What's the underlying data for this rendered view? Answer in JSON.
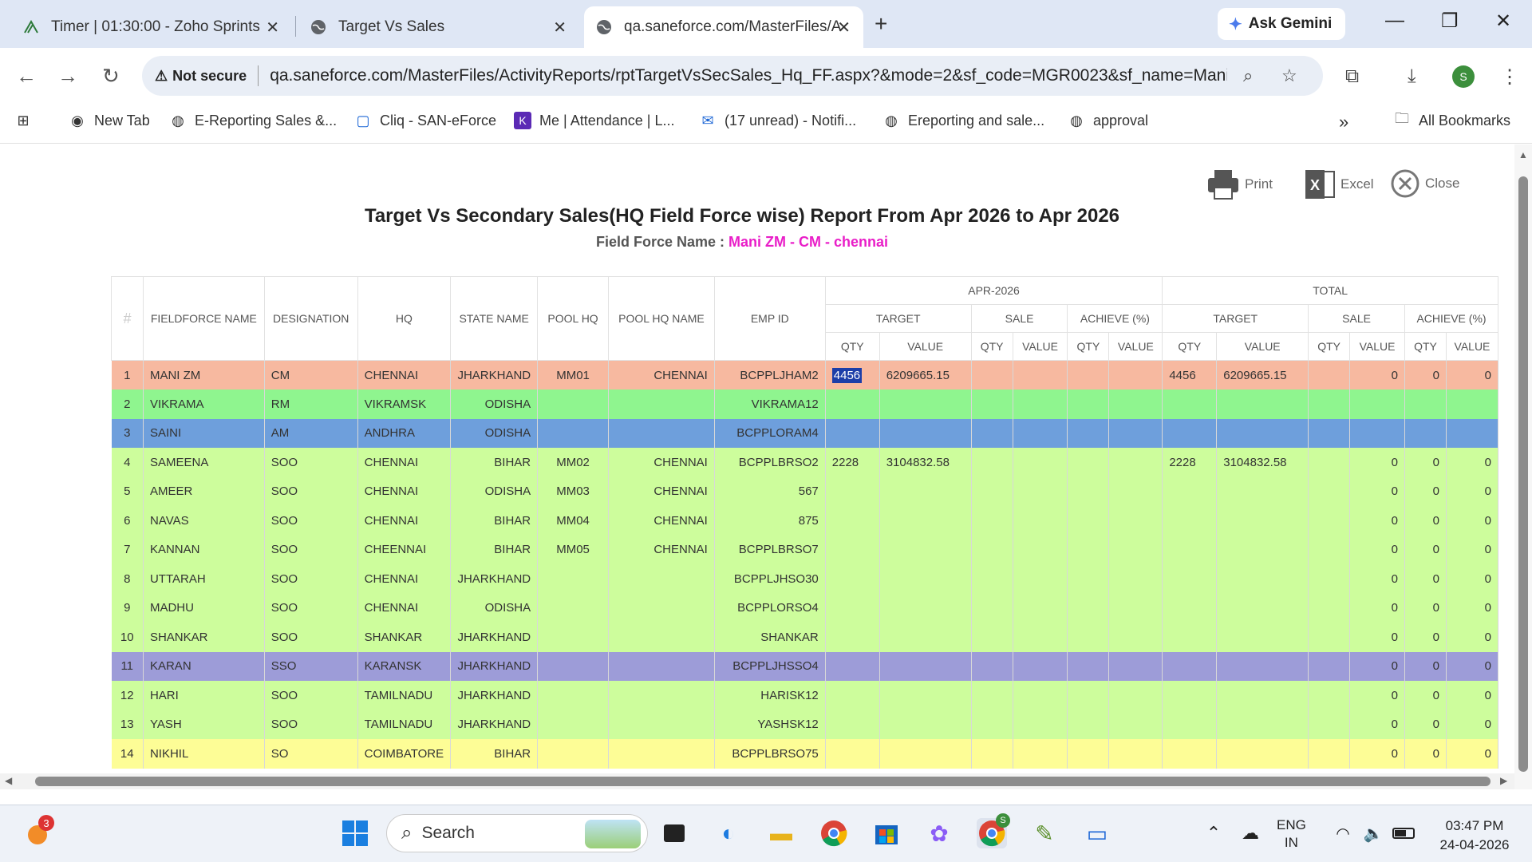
{
  "browser": {
    "tabs": [
      {
        "title": "Timer | 01:30:00 - Zoho Sprints"
      },
      {
        "title": "Target Vs Sales"
      },
      {
        "title": "qa.saneforce.com/MasterFiles/A"
      }
    ],
    "new_tab": "+",
    "gemini_label": "Ask Gemini",
    "not_secure": "Not secure",
    "url": "qa.saneforce.com/MasterFiles/ActivityReports/rptTargetVsSecSales_Hq_FF.aspx?&mode=2&sf_code=MGR0023&sf_name=Mani...",
    "profile_initial": "S",
    "bookmarks": [
      "New Tab",
      "E-Reporting Sales &...",
      "Cliq - SAN-eForce",
      "Me | Attendance | L...",
      "(17 unread) - Notifi...",
      "Ereporting and sale...",
      "approval"
    ],
    "more_bookmarks": "»",
    "all_bookmarks": "All Bookmarks"
  },
  "actions": {
    "print": "Print",
    "excel": "Excel",
    "close": "Close"
  },
  "report": {
    "title": "Target Vs Secondary Sales(HQ Field Force wise) Report From Apr 2026 to Apr 2026",
    "ff_label": "Field Force Name :",
    "ff_name": "Mani ZM - CM - chennai"
  },
  "table": {
    "headers": {
      "num": "#",
      "fieldforce": "FIELDFORCE NAME",
      "designation": "DESIGNATION",
      "hq": "HQ",
      "state": "STATE NAME",
      "pool_hq": "POOL HQ",
      "pool_hq_name": "POOL HQ NAME",
      "emp_id": "EMP ID",
      "month": "APR-2026",
      "total": "TOTAL",
      "target": "TARGET",
      "sale": "SALE",
      "achieve": "ACHIEVE (%)",
      "qty": "QTY",
      "value": "VALUE"
    },
    "rows": [
      {
        "n": "1",
        "name": "MANI ZM",
        "desg": "CM",
        "hq": "CHENNAI",
        "state": "JHARKHAND",
        "pool": "MM01",
        "poolname": "CHENNAI",
        "emp": "BCPPLJHAM2",
        "t_qty": "4456",
        "t_val": "6209665.15",
        "s_qty": "",
        "s_val": "",
        "a_qty": "",
        "a_val": "",
        "tt_qty": "4456",
        "tt_val": "6209665.15",
        "ts_qty": "",
        "ts_val": "0",
        "ta_qty": "0",
        "ta_val": "0",
        "bg": "#f7b9a0"
      },
      {
        "n": "2",
        "name": "VIKRAMA",
        "desg": "RM",
        "hq": "VIKRAMSK",
        "state": "ODISHA",
        "pool": "",
        "poolname": "",
        "emp": "VIKRAMA12",
        "t_qty": "",
        "t_val": "",
        "s_qty": "",
        "s_val": "",
        "a_qty": "",
        "a_val": "",
        "tt_qty": "",
        "tt_val": "",
        "ts_qty": "",
        "ts_val": "",
        "ta_qty": "",
        "ta_val": "",
        "bg": "#8ff58f"
      },
      {
        "n": "3",
        "name": "SAINI",
        "desg": "AM",
        "hq": "ANDHRA",
        "state": "ODISHA",
        "pool": "",
        "poolname": "",
        "emp": "BCPPLORAM4",
        "t_qty": "",
        "t_val": "",
        "s_qty": "",
        "s_val": "",
        "a_qty": "",
        "a_val": "",
        "tt_qty": "",
        "tt_val": "",
        "ts_qty": "",
        "ts_val": "",
        "ta_qty": "",
        "ta_val": "",
        "bg": "#6e9fdc"
      },
      {
        "n": "4",
        "name": "SAMEENA",
        "desg": "SOO",
        "hq": "CHENNAI",
        "state": "BIHAR",
        "pool": "MM02",
        "poolname": "CHENNAI",
        "emp": "BCPPLBRSO2",
        "t_qty": "2228",
        "t_val": "3104832.58",
        "s_qty": "",
        "s_val": "",
        "a_qty": "",
        "a_val": "",
        "tt_qty": "2228",
        "tt_val": "3104832.58",
        "ts_qty": "",
        "ts_val": "0",
        "ta_qty": "0",
        "ta_val": "0",
        "bg": "#cdfd9c"
      },
      {
        "n": "5",
        "name": "AMEER",
        "desg": "SOO",
        "hq": "CHENNAI",
        "state": "ODISHA",
        "pool": "MM03",
        "poolname": "CHENNAI",
        "emp": "567",
        "t_qty": "",
        "t_val": "",
        "s_qty": "",
        "s_val": "",
        "a_qty": "",
        "a_val": "",
        "tt_qty": "",
        "tt_val": "",
        "ts_qty": "",
        "ts_val": "0",
        "ta_qty": "0",
        "ta_val": "0",
        "bg": "#cdfd9c"
      },
      {
        "n": "6",
        "name": "NAVAS",
        "desg": "SOO",
        "hq": "CHENNAI",
        "state": "BIHAR",
        "pool": "MM04",
        "poolname": "CHENNAI",
        "emp": "875",
        "t_qty": "",
        "t_val": "",
        "s_qty": "",
        "s_val": "",
        "a_qty": "",
        "a_val": "",
        "tt_qty": "",
        "tt_val": "",
        "ts_qty": "",
        "ts_val": "0",
        "ta_qty": "0",
        "ta_val": "0",
        "bg": "#cdfd9c"
      },
      {
        "n": "7",
        "name": "KANNAN",
        "desg": "SOO",
        "hq": "CHEENNAI",
        "state": "BIHAR",
        "pool": "MM05",
        "poolname": "CHENNAI",
        "emp": "BCPPLBRSO7",
        "t_qty": "",
        "t_val": "",
        "s_qty": "",
        "s_val": "",
        "a_qty": "",
        "a_val": "",
        "tt_qty": "",
        "tt_val": "",
        "ts_qty": "",
        "ts_val": "0",
        "ta_qty": "0",
        "ta_val": "0",
        "bg": "#cdfd9c"
      },
      {
        "n": "8",
        "name": "UTTARAH",
        "desg": "SOO",
        "hq": "CHENNAI",
        "state": "JHARKHAND",
        "pool": "",
        "poolname": "",
        "emp": "BCPPLJHSO30",
        "t_qty": "",
        "t_val": "",
        "s_qty": "",
        "s_val": "",
        "a_qty": "",
        "a_val": "",
        "tt_qty": "",
        "tt_val": "",
        "ts_qty": "",
        "ts_val": "0",
        "ta_qty": "0",
        "ta_val": "0",
        "bg": "#cdfd9c"
      },
      {
        "n": "9",
        "name": "MADHU",
        "desg": "SOO",
        "hq": "CHENNAI",
        "state": "ODISHA",
        "pool": "",
        "poolname": "",
        "emp": "BCPPLORSO4",
        "t_qty": "",
        "t_val": "",
        "s_qty": "",
        "s_val": "",
        "a_qty": "",
        "a_val": "",
        "tt_qty": "",
        "tt_val": "",
        "ts_qty": "",
        "ts_val": "0",
        "ta_qty": "0",
        "ta_val": "0",
        "bg": "#cdfd9c"
      },
      {
        "n": "10",
        "name": "SHANKAR",
        "desg": "SOO",
        "hq": "SHANKAR",
        "state": "JHARKHAND",
        "pool": "",
        "poolname": "",
        "emp": "SHANKAR",
        "t_qty": "",
        "t_val": "",
        "s_qty": "",
        "s_val": "",
        "a_qty": "",
        "a_val": "",
        "tt_qty": "",
        "tt_val": "",
        "ts_qty": "",
        "ts_val": "0",
        "ta_qty": "0",
        "ta_val": "0",
        "bg": "#cdfd9c"
      },
      {
        "n": "11",
        "name": "KARAN",
        "desg": "SSO",
        "hq": "KARANSK",
        "state": "JHARKHAND",
        "pool": "",
        "poolname": "",
        "emp": "BCPPLJHSSO4",
        "t_qty": "",
        "t_val": "",
        "s_qty": "",
        "s_val": "",
        "a_qty": "",
        "a_val": "",
        "tt_qty": "",
        "tt_val": "",
        "ts_qty": "",
        "ts_val": "0",
        "ta_qty": "0",
        "ta_val": "0",
        "bg": "#9d9cd8"
      },
      {
        "n": "12",
        "name": "HARI",
        "desg": "SOO",
        "hq": "TAMILNADU",
        "state": "JHARKHAND",
        "pool": "",
        "poolname": "",
        "emp": "HARISK12",
        "t_qty": "",
        "t_val": "",
        "s_qty": "",
        "s_val": "",
        "a_qty": "",
        "a_val": "",
        "tt_qty": "",
        "tt_val": "",
        "ts_qty": "",
        "ts_val": "0",
        "ta_qty": "0",
        "ta_val": "0",
        "bg": "#cdfd9c"
      },
      {
        "n": "13",
        "name": "YASH",
        "desg": "SOO",
        "hq": "TAMILNADU",
        "state": "JHARKHAND",
        "pool": "",
        "poolname": "",
        "emp": "YASHSK12",
        "t_qty": "",
        "t_val": "",
        "s_qty": "",
        "s_val": "",
        "a_qty": "",
        "a_val": "",
        "tt_qty": "",
        "tt_val": "",
        "ts_qty": "",
        "ts_val": "0",
        "ta_qty": "0",
        "ta_val": "0",
        "bg": "#cdfd9c"
      },
      {
        "n": "14",
        "name": "NIKHIL",
        "desg": "SO",
        "hq": "COIMBATORE",
        "state": "BIHAR",
        "pool": "",
        "poolname": "",
        "emp": "BCPPLBRSO75",
        "t_qty": "",
        "t_val": "",
        "s_qty": "",
        "s_val": "",
        "a_qty": "",
        "a_val": "",
        "tt_qty": "",
        "tt_val": "",
        "ts_qty": "",
        "ts_val": "0",
        "ta_qty": "0",
        "ta_val": "0",
        "bg": "#fdfd96"
      }
    ]
  },
  "taskbar": {
    "search_placeholder": "Search",
    "notif_badge": "3",
    "chrome_badge": "S",
    "lang_top": "ENG",
    "lang_bottom": "IN",
    "time": "03:47 PM",
    "date": "24-04-2026"
  }
}
